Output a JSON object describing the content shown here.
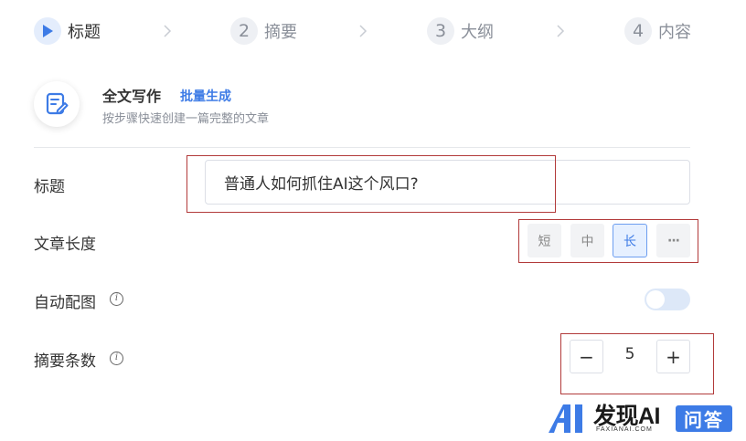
{
  "steps": [
    {
      "number": "",
      "label": "标题",
      "active": true
    },
    {
      "number": "2",
      "label": "摘要",
      "active": false
    },
    {
      "number": "3",
      "label": "大纲",
      "active": false
    },
    {
      "number": "4",
      "label": "内容",
      "active": false
    }
  ],
  "header": {
    "title": "全文写作",
    "batch_link": "批量生成",
    "subtitle": "按步骤快速创建一篇完整的文章"
  },
  "form": {
    "title_label": "标题",
    "title_value": "普通人如何抓住AI这个风口?",
    "length_label": "文章长度",
    "length_options": [
      "短",
      "中",
      "长",
      "···"
    ],
    "length_selected": "长",
    "auto_image_label": "自动配图",
    "auto_image_on": false,
    "summary_count_label": "摘要条数",
    "summary_count_value": "5",
    "minus_label": "−",
    "plus_label": "+"
  },
  "watermark": {
    "brand": "发现AI",
    "domain": "FAXIANAI.COM",
    "badge": "问答"
  },
  "colors": {
    "accent": "#3d7be6",
    "annotation_red": "#b23a3a",
    "muted_text": "#8a8f99"
  }
}
